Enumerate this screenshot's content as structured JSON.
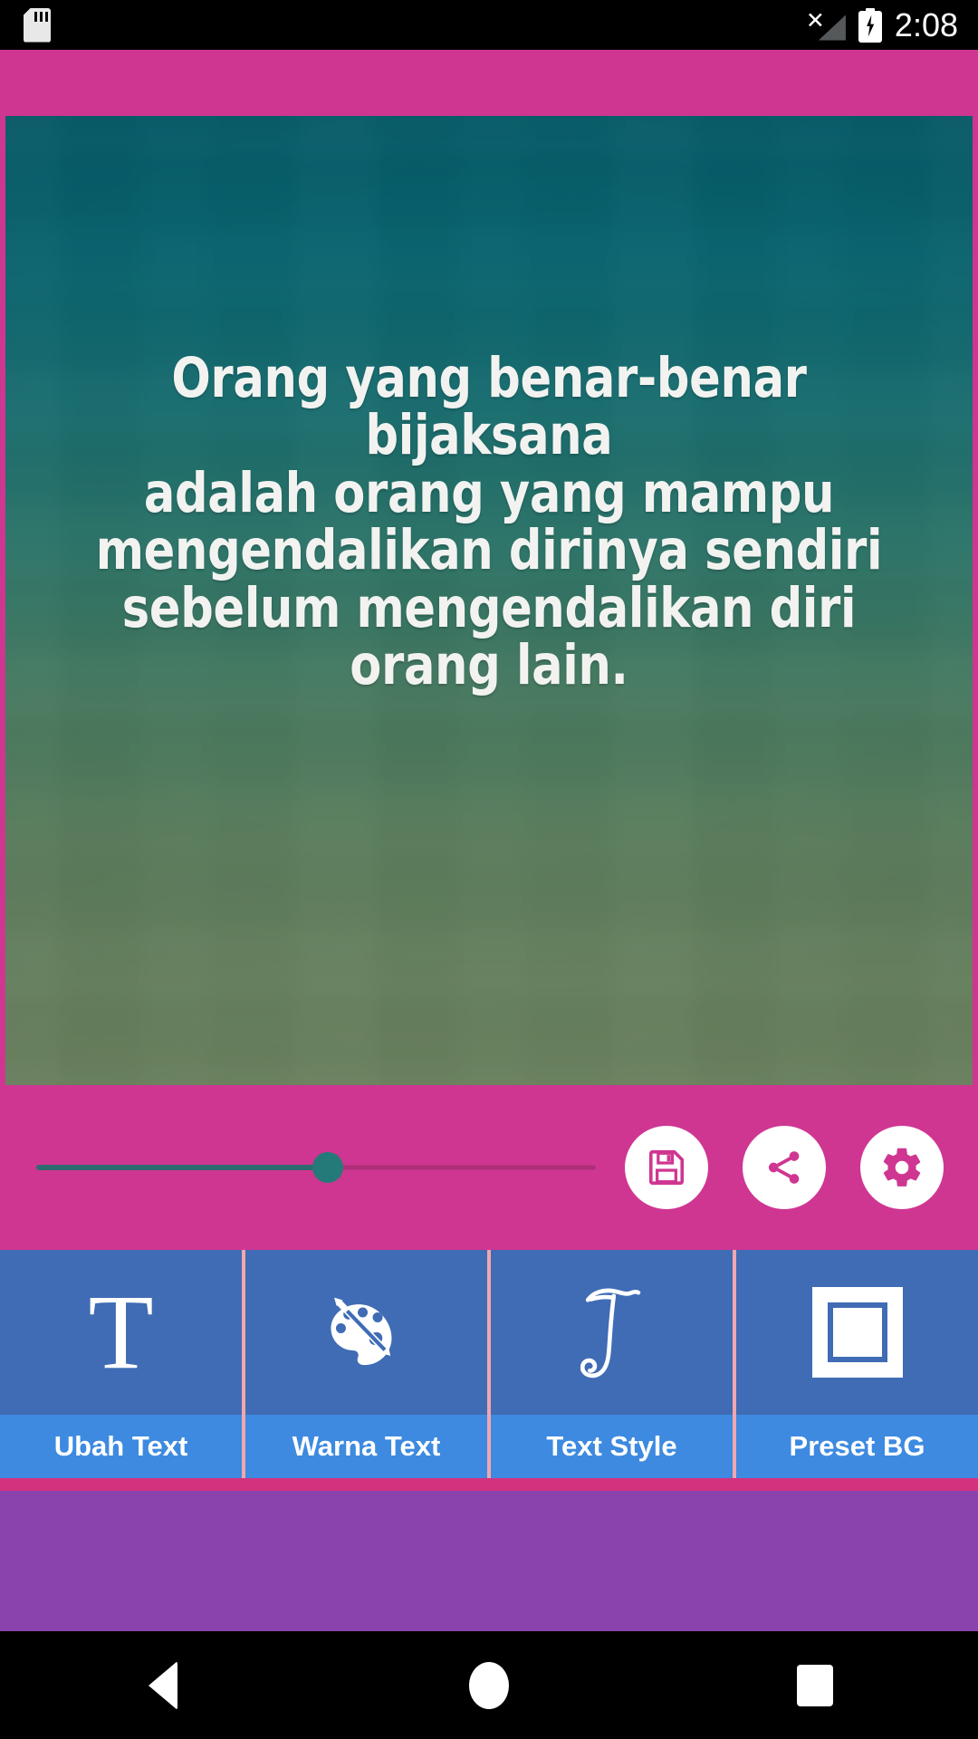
{
  "status_bar": {
    "sd_card_icon": "sd-card-icon",
    "signal_icon": "no-signal-icon",
    "battery_icon": "battery-charging-icon",
    "time": "2:08"
  },
  "canvas": {
    "quote_text": "Orang yang benar-benar bijaksana\nadalah orang yang mampu\nmengendalikan dirinya sendiri\nsebelum mengendalikan diri\norang lain."
  },
  "controls": {
    "slider": {
      "name": "text-size-slider",
      "value_percent": 52,
      "fill_color": "#2f6a70",
      "thumb_color": "#247a78",
      "track_color": "#ad3078"
    },
    "buttons": [
      {
        "name": "save-button",
        "icon": "save-floppy-icon",
        "icon_color": "#cf3691"
      },
      {
        "name": "share-button",
        "icon": "share-icon",
        "icon_color": "#cf3691"
      },
      {
        "name": "settings-button",
        "icon": "gear-icon",
        "icon_color": "#cf3691"
      }
    ]
  },
  "toolbar": {
    "items": [
      {
        "label": "Ubah Text",
        "icon": "serif-letter-t-icon"
      },
      {
        "label": "Warna Text",
        "icon": "palette-brush-icon"
      },
      {
        "label": "Text Style",
        "icon": "script-letter-t-icon"
      },
      {
        "label": "Preset BG",
        "icon": "square-frame-icon"
      }
    ],
    "icon_bg_color": "#3f6cb4",
    "label_bg_color": "#3d8ae0",
    "divider_color": "#f1a7ad"
  },
  "theme": {
    "accent_pink": "#cf3691",
    "ad_purple": "#8a43ad",
    "strip_pink": "#d3327f"
  },
  "navbar": {
    "back": "back-triangle-icon",
    "home": "home-circle-icon",
    "recents": "recents-square-icon"
  }
}
